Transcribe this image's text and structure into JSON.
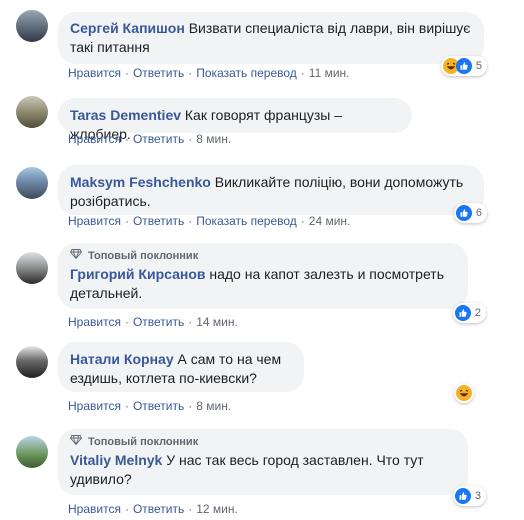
{
  "actions": {
    "like": "Нравится",
    "reply": "Ответить",
    "translate": "Показать перевод",
    "sep": "·"
  },
  "fan_badge": "Топовый поклонник",
  "comments": [
    {
      "author": "Сергей Капишон",
      "text": "Визвати специаліста від лаври, він вирішує такі питання",
      "time": "11 мин.",
      "reactions": [
        "haha",
        "like"
      ],
      "reaction_count": "5"
    },
    {
      "author": "Taras Dementiev",
      "text": "Как говорят французы – жлобиер.",
      "time": "8 мин."
    },
    {
      "author": "Maksym Feshchenko",
      "text": "Викликайте поліцію, вони допоможуть розібратись.",
      "time": "24 мин.",
      "reactions": [
        "like"
      ],
      "reaction_count": "6"
    },
    {
      "author": "Григорий Кирсанов",
      "text": "надо на капот залезть и посмотреть детальней.",
      "time": "14 мин.",
      "reactions": [
        "like"
      ],
      "reaction_count": "2"
    },
    {
      "author": "Натали Корнау",
      "text": "А сам то на чем ездишь, котлета по-киевски?",
      "time": "8 мин.",
      "reactions": [
        "haha"
      ]
    },
    {
      "author": "Vitaliy Melnyk",
      "text": "У нас так весь город заставлен. Что тут удивило?",
      "time": "12 мин.",
      "reactions": [
        "like"
      ],
      "reaction_count": "3"
    }
  ],
  "colors": {
    "link": "#385898",
    "meta": "#606770",
    "bubble": "#f2f3f5",
    "like": "#1877f2",
    "haha": "#f7b125"
  }
}
